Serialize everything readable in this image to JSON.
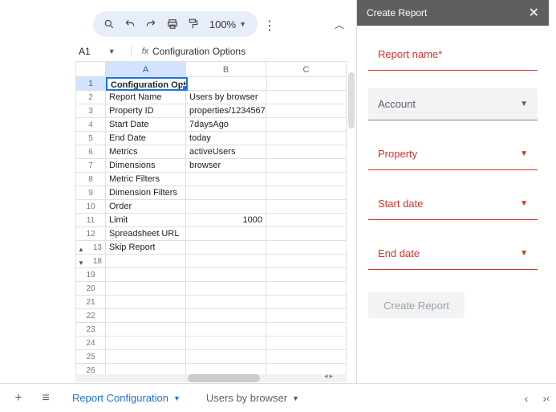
{
  "toolbar": {
    "zoom": "100%"
  },
  "namebox": {
    "cell": "A1",
    "formula": "Configuration Options"
  },
  "columns": [
    "A",
    "B",
    "C"
  ],
  "rows": [
    {
      "n": "1",
      "a": "Configuration Options",
      "b": "",
      "c": "",
      "bold": true,
      "selected": true
    },
    {
      "n": "2",
      "a": "Report Name",
      "b": "Users by browser",
      "c": ""
    },
    {
      "n": "3",
      "a": "Property ID",
      "b": "properties/1234567",
      "c": ""
    },
    {
      "n": "4",
      "a": "Start Date",
      "b": "7daysAgo",
      "c": ""
    },
    {
      "n": "5",
      "a": "End Date",
      "b": "today",
      "c": ""
    },
    {
      "n": "6",
      "a": "Metrics",
      "b": "activeUsers",
      "c": ""
    },
    {
      "n": "7",
      "a": "Dimensions",
      "b": "browser",
      "c": ""
    },
    {
      "n": "8",
      "a": "Metric Filters",
      "b": "",
      "c": ""
    },
    {
      "n": "9",
      "a": "Dimension Filters",
      "b": "",
      "c": ""
    },
    {
      "n": "10",
      "a": "Order",
      "b": "",
      "c": ""
    },
    {
      "n": "11",
      "a": "Limit",
      "b": "1000",
      "c": "",
      "bRight": true
    },
    {
      "n": "12",
      "a": "Spreadsheet URL",
      "b": "",
      "c": ""
    },
    {
      "n": "13",
      "a": "Skip Report",
      "b": "",
      "c": "",
      "caret": "▲"
    },
    {
      "n": "18",
      "a": "",
      "b": "",
      "c": "",
      "caret": "▼"
    },
    {
      "n": "19",
      "a": "",
      "b": "",
      "c": ""
    },
    {
      "n": "20",
      "a": "",
      "b": "",
      "c": ""
    },
    {
      "n": "21",
      "a": "",
      "b": "",
      "c": ""
    },
    {
      "n": "22",
      "a": "",
      "b": "",
      "c": ""
    },
    {
      "n": "23",
      "a": "",
      "b": "",
      "c": ""
    },
    {
      "n": "24",
      "a": "",
      "b": "",
      "c": ""
    },
    {
      "n": "25",
      "a": "",
      "b": "",
      "c": ""
    },
    {
      "n": "26",
      "a": "",
      "b": "",
      "c": ""
    }
  ],
  "sidebar": {
    "title": "Create Report",
    "fields": {
      "report_name": "Report name*",
      "account": "Account",
      "property": "Property",
      "start_date": "Start date",
      "end_date": "End date"
    },
    "button": "Create Report"
  },
  "sheets": {
    "tab1": "Report Configuration",
    "tab2": "Users by browser"
  }
}
